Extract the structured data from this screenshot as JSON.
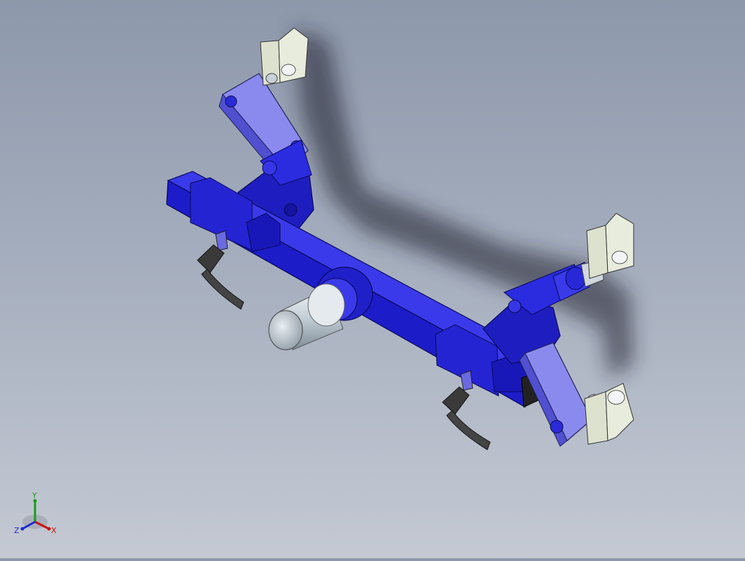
{
  "viewport": {
    "background_top": "#8d98ab",
    "background_bottom": "#c4c9d3",
    "model_color": "#1c1cc9",
    "model_highlight": "#3a3aea",
    "link_color": "#8a8aee",
    "shaft_color": "#c8d4dc"
  },
  "triad": {
    "x_label": "X",
    "y_label": "Y",
    "z_label": "Z",
    "x_color": "#cc1111",
    "y_color": "#14a014",
    "z_color": "#1a2ad0"
  }
}
